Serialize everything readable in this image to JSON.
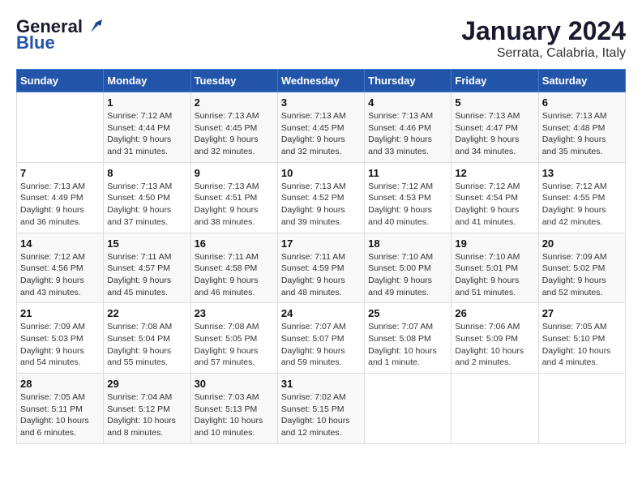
{
  "header": {
    "logo_general": "General",
    "logo_blue": "Blue",
    "month": "January 2024",
    "location": "Serrata, Calabria, Italy"
  },
  "weekdays": [
    "Sunday",
    "Monday",
    "Tuesday",
    "Wednesday",
    "Thursday",
    "Friday",
    "Saturday"
  ],
  "weeks": [
    [
      {
        "day": "",
        "info": ""
      },
      {
        "day": "1",
        "info": "Sunrise: 7:12 AM\nSunset: 4:44 PM\nDaylight: 9 hours\nand 31 minutes."
      },
      {
        "day": "2",
        "info": "Sunrise: 7:13 AM\nSunset: 4:45 PM\nDaylight: 9 hours\nand 32 minutes."
      },
      {
        "day": "3",
        "info": "Sunrise: 7:13 AM\nSunset: 4:45 PM\nDaylight: 9 hours\nand 32 minutes."
      },
      {
        "day": "4",
        "info": "Sunrise: 7:13 AM\nSunset: 4:46 PM\nDaylight: 9 hours\nand 33 minutes."
      },
      {
        "day": "5",
        "info": "Sunrise: 7:13 AM\nSunset: 4:47 PM\nDaylight: 9 hours\nand 34 minutes."
      },
      {
        "day": "6",
        "info": "Sunrise: 7:13 AM\nSunset: 4:48 PM\nDaylight: 9 hours\nand 35 minutes."
      }
    ],
    [
      {
        "day": "7",
        "info": "Sunrise: 7:13 AM\nSunset: 4:49 PM\nDaylight: 9 hours\nand 36 minutes."
      },
      {
        "day": "8",
        "info": "Sunrise: 7:13 AM\nSunset: 4:50 PM\nDaylight: 9 hours\nand 37 minutes."
      },
      {
        "day": "9",
        "info": "Sunrise: 7:13 AM\nSunset: 4:51 PM\nDaylight: 9 hours\nand 38 minutes."
      },
      {
        "day": "10",
        "info": "Sunrise: 7:13 AM\nSunset: 4:52 PM\nDaylight: 9 hours\nand 39 minutes."
      },
      {
        "day": "11",
        "info": "Sunrise: 7:12 AM\nSunset: 4:53 PM\nDaylight: 9 hours\nand 40 minutes."
      },
      {
        "day": "12",
        "info": "Sunrise: 7:12 AM\nSunset: 4:54 PM\nDaylight: 9 hours\nand 41 minutes."
      },
      {
        "day": "13",
        "info": "Sunrise: 7:12 AM\nSunset: 4:55 PM\nDaylight: 9 hours\nand 42 minutes."
      }
    ],
    [
      {
        "day": "14",
        "info": "Sunrise: 7:12 AM\nSunset: 4:56 PM\nDaylight: 9 hours\nand 43 minutes."
      },
      {
        "day": "15",
        "info": "Sunrise: 7:11 AM\nSunset: 4:57 PM\nDaylight: 9 hours\nand 45 minutes."
      },
      {
        "day": "16",
        "info": "Sunrise: 7:11 AM\nSunset: 4:58 PM\nDaylight: 9 hours\nand 46 minutes."
      },
      {
        "day": "17",
        "info": "Sunrise: 7:11 AM\nSunset: 4:59 PM\nDaylight: 9 hours\nand 48 minutes."
      },
      {
        "day": "18",
        "info": "Sunrise: 7:10 AM\nSunset: 5:00 PM\nDaylight: 9 hours\nand 49 minutes."
      },
      {
        "day": "19",
        "info": "Sunrise: 7:10 AM\nSunset: 5:01 PM\nDaylight: 9 hours\nand 51 minutes."
      },
      {
        "day": "20",
        "info": "Sunrise: 7:09 AM\nSunset: 5:02 PM\nDaylight: 9 hours\nand 52 minutes."
      }
    ],
    [
      {
        "day": "21",
        "info": "Sunrise: 7:09 AM\nSunset: 5:03 PM\nDaylight: 9 hours\nand 54 minutes."
      },
      {
        "day": "22",
        "info": "Sunrise: 7:08 AM\nSunset: 5:04 PM\nDaylight: 9 hours\nand 55 minutes."
      },
      {
        "day": "23",
        "info": "Sunrise: 7:08 AM\nSunset: 5:05 PM\nDaylight: 9 hours\nand 57 minutes."
      },
      {
        "day": "24",
        "info": "Sunrise: 7:07 AM\nSunset: 5:07 PM\nDaylight: 9 hours\nand 59 minutes."
      },
      {
        "day": "25",
        "info": "Sunrise: 7:07 AM\nSunset: 5:08 PM\nDaylight: 10 hours\nand 1 minute."
      },
      {
        "day": "26",
        "info": "Sunrise: 7:06 AM\nSunset: 5:09 PM\nDaylight: 10 hours\nand 2 minutes."
      },
      {
        "day": "27",
        "info": "Sunrise: 7:05 AM\nSunset: 5:10 PM\nDaylight: 10 hours\nand 4 minutes."
      }
    ],
    [
      {
        "day": "28",
        "info": "Sunrise: 7:05 AM\nSunset: 5:11 PM\nDaylight: 10 hours\nand 6 minutes."
      },
      {
        "day": "29",
        "info": "Sunrise: 7:04 AM\nSunset: 5:12 PM\nDaylight: 10 hours\nand 8 minutes."
      },
      {
        "day": "30",
        "info": "Sunrise: 7:03 AM\nSunset: 5:13 PM\nDaylight: 10 hours\nand 10 minutes."
      },
      {
        "day": "31",
        "info": "Sunrise: 7:02 AM\nSunset: 5:15 PM\nDaylight: 10 hours\nand 12 minutes."
      },
      {
        "day": "",
        "info": ""
      },
      {
        "day": "",
        "info": ""
      },
      {
        "day": "",
        "info": ""
      }
    ]
  ]
}
